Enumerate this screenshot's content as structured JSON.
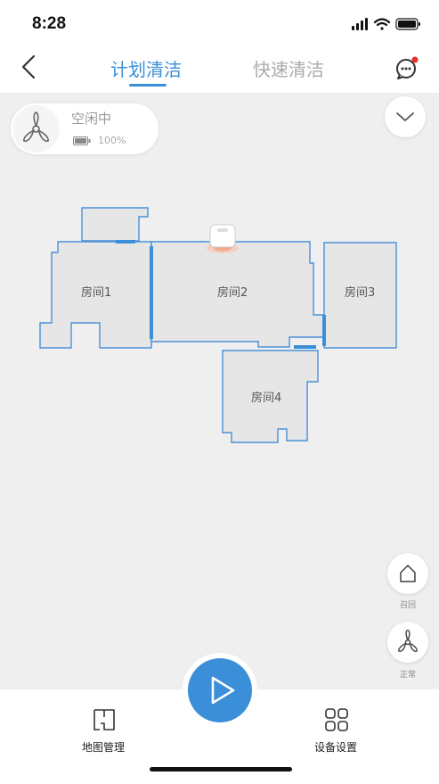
{
  "status_bar": {
    "time": "8:28"
  },
  "header": {
    "tabs": [
      {
        "label": "计划清洁",
        "active": true
      },
      {
        "label": "快速清洁",
        "active": false
      }
    ]
  },
  "device_status": {
    "state": "空闲中",
    "battery": "100%"
  },
  "map": {
    "rooms": [
      {
        "label": "房间1"
      },
      {
        "label": "房间2"
      },
      {
        "label": "房间3"
      },
      {
        "label": "房间4"
      }
    ]
  },
  "side_buttons": {
    "recall_label": "召回",
    "suction_label": "正常"
  },
  "bottom_bar": {
    "map_manage_label": "地图管理",
    "device_settings_label": "设备设置"
  },
  "colors": {
    "accent": "#3a8fd8",
    "wall": "#4a90d9",
    "room_fill": "#e6e6e6",
    "background": "#efefef"
  },
  "icons": [
    "back-icon",
    "chat-icon",
    "fan-icon",
    "battery-icon",
    "chevron-down-icon",
    "robot-icon",
    "home-icon",
    "fan-icon",
    "play-icon",
    "map-icon",
    "grid-icon"
  ]
}
